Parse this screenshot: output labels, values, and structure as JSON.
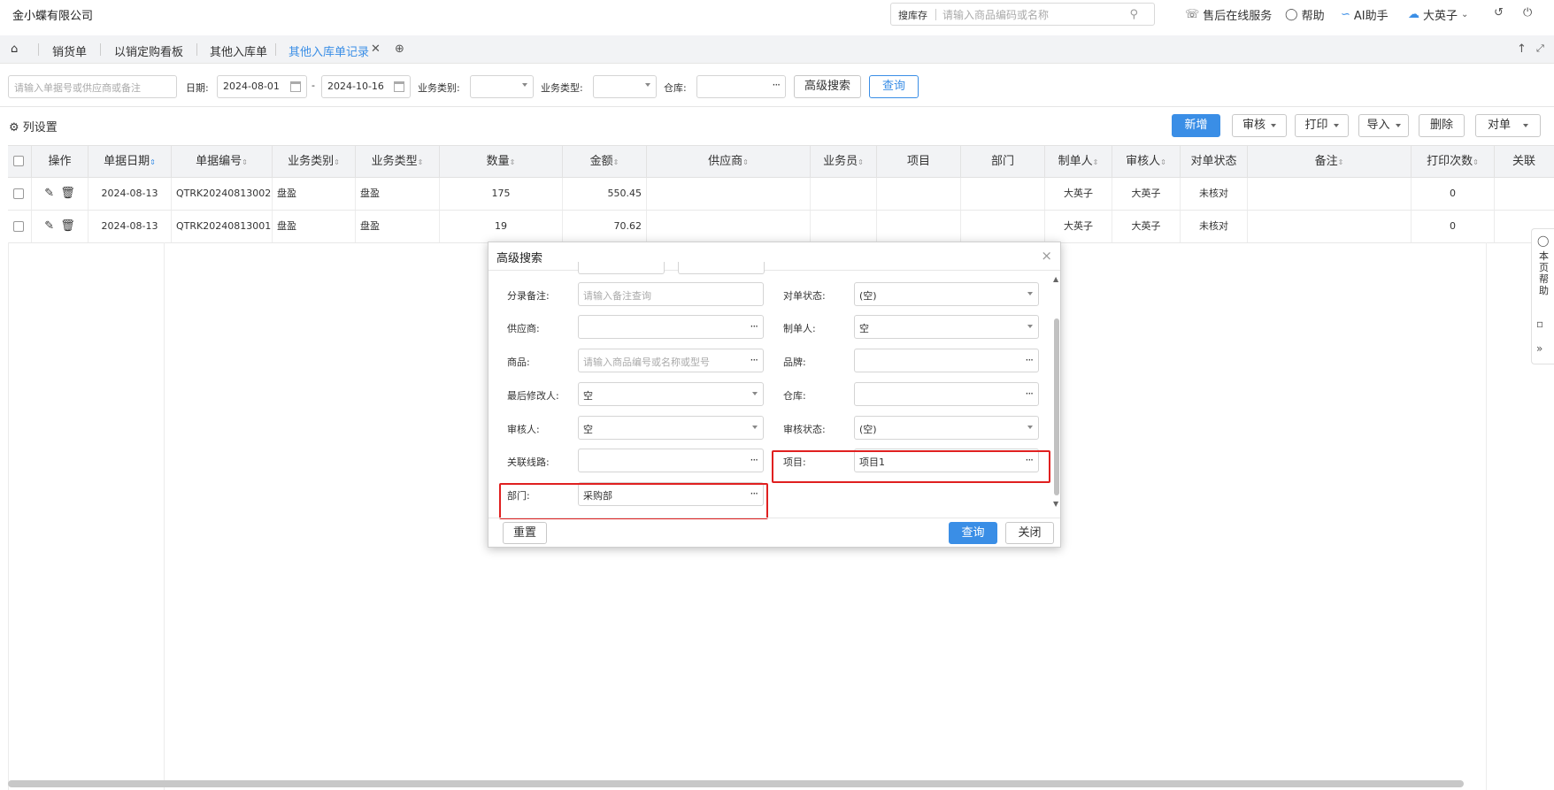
{
  "header": {
    "company": "金小蝶有限公司",
    "search_tag": "搜库存",
    "search_placeholder": "请输入商品编码或名称",
    "after_sales": "售后在线服务",
    "help": "帮助",
    "ai": "AI助手",
    "user": "大英子"
  },
  "tabs": {
    "items": [
      "销货单",
      "以销定购看板",
      "其他入库单",
      "其他入库单记录"
    ],
    "active_index": 3
  },
  "filters": {
    "keyword_placeholder": "请输入单据号或供应商或备注",
    "date_label": "日期:",
    "date_from": "2024-08-01",
    "date_to": "2024-10-16",
    "date_sep": "-",
    "biz_category_label": "业务类别:",
    "biz_type_label": "业务类型:",
    "warehouse_label": "仓库:",
    "advanced_btn": "高级搜索",
    "query_btn": "查询"
  },
  "toolbar": {
    "column_settings": "列设置",
    "add": "新增",
    "audit": "审核",
    "print": "打印",
    "import": "导入",
    "delete": "删除",
    "reconcile": "对单"
  },
  "table": {
    "columns": [
      "操作",
      "单据日期",
      "单据编号",
      "业务类别",
      "业务类型",
      "数量",
      "金额",
      "供应商",
      "业务员",
      "项目",
      "部门",
      "制单人",
      "审核人",
      "对单状态",
      "备注",
      "打印次数",
      "关联"
    ],
    "rows": [
      {
        "date": "2024-08-13",
        "no": "QTRK20240813002",
        "category": "盘盈",
        "type": "盘盈",
        "qty": "175",
        "amount": "550.45",
        "creator": "大英子",
        "auditor": "大英子",
        "status": "未核对",
        "prints": "0"
      },
      {
        "date": "2024-08-13",
        "no": "QTRK20240813001",
        "category": "盘盈",
        "type": "盘盈",
        "qty": "19",
        "amount": "70.62",
        "creator": "大英子",
        "auditor": "大英子",
        "status": "未核对",
        "prints": "0"
      }
    ]
  },
  "modal": {
    "title": "高级搜索",
    "entry_remark_label": "分录备注:",
    "entry_remark_placeholder": "请输入备注查询",
    "reconcile_status_label": "对单状态:",
    "reconcile_status_value": "(空)",
    "supplier_label": "供应商:",
    "creator_label": "制单人:",
    "creator_value": "空",
    "goods_label": "商品:",
    "goods_placeholder": "请输入商品编号或名称或型号",
    "brand_label": "品牌:",
    "last_modifier_label": "最后修改人:",
    "last_modifier_value": "空",
    "warehouse_label": "仓库:",
    "auditor_label": "审核人:",
    "auditor_value": "空",
    "audit_status_label": "审核状态:",
    "audit_status_value": "(空)",
    "route_label": "关联线路:",
    "project_label": "项目:",
    "project_value": "项目1",
    "dept_label": "部门:",
    "dept_value": "采购部",
    "reset_btn": "重置",
    "query_btn": "查询",
    "close_btn": "关闭"
  },
  "side_panel": {
    "help_text": "本页帮助"
  },
  "colors": {
    "accent": "#3a8ee6",
    "highlight": "#e02020"
  }
}
